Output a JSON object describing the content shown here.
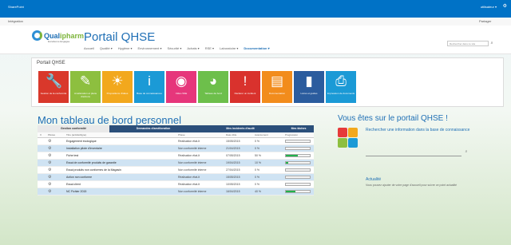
{
  "topbar": {
    "brand": "SharePoint",
    "user": "utilisateur ▾",
    "gear": "⚙"
  },
  "subbar": {
    "left": "Intégration",
    "right": "Partager"
  },
  "header": {
    "logo_word_a": "Qual",
    "logo_word_b": "ipharm",
    "logo_tag": "Excellence Engagée",
    "title": "Portail QHSE",
    "nav": [
      "Accueil",
      "Qualité ▾",
      "Hygiène ▾",
      "Environnement ▾",
      "Sécurité ▾",
      "Achats ▾",
      "RSE ▾",
      "Laboratoire ▾",
      "Documentation ▾"
    ],
    "nav_active_index": 8,
    "search_placeholder": "Rechercher dans ce site"
  },
  "portal": {
    "title": "Portail QHSE",
    "tiles": [
      {
        "label": "Gestion de la conformité",
        "icon": "wrench-icon",
        "glyph": "🔧",
        "color": "#d9382b"
      },
      {
        "label": "Amélioration et plans d'actions",
        "icon": "magic-wand-icon",
        "glyph": "✎",
        "color": "#8dbf3f"
      },
      {
        "label": "Propositions d'idées",
        "icon": "lightbulb-icon",
        "glyph": "☀",
        "color": "#f2a81d"
      },
      {
        "label": "Base de connaissances",
        "icon": "info-icon",
        "glyph": "i",
        "color": "#1b9ad6"
      },
      {
        "label": "Vidéo SSE",
        "icon": "camera-shutter-icon",
        "glyph": "◉",
        "color": "#e6367b"
      },
      {
        "label": "Tableau de bord",
        "icon": "palette-icon",
        "glyph": "◕",
        "color": "#6dbf4b"
      },
      {
        "label": "Déclarer un incident",
        "icon": "warning-icon",
        "glyph": "!",
        "color": "#d9322d"
      },
      {
        "label": "Documentation",
        "icon": "document-icon",
        "glyph": "▤",
        "color": "#f28c1c"
      },
      {
        "label": "Livres et guides",
        "icon": "book-icon",
        "glyph": "▮",
        "color": "#2b5c9e"
      },
      {
        "label": "Impression de documents",
        "icon": "printer-icon",
        "glyph": "⎙",
        "color": "#1b9ad6"
      }
    ]
  },
  "dashboard": {
    "title": "Mon tableau de bord personnel",
    "tabs": [
      "Gestion conformité",
      "Demandes d'amélioration",
      "Mes incidents d'audit",
      "Mes tâches"
    ],
    "columns": [
      "V",
      "Pilotes",
      "Titre (activité/ligne)",
      "Phase",
      "Date cible",
      "Avancement",
      "Progression"
    ],
    "rows": [
      {
        "title": "Engagement écologique",
        "phase": "Réalisation état-lt",
        "date": "15/05/2015",
        "pct": "0 %",
        "progress": 0
      },
      {
        "title": "Installation pilote d'inventaire",
        "phase": "Non conformité interne",
        "date": "21/04/2015",
        "pct": "0 %",
        "progress": 0
      },
      {
        "title": "Fiche test",
        "phase": "Réalisation état-lt",
        "date": "07/05/2015",
        "pct": "50 %",
        "progress": 50
      },
      {
        "title": "Essai de conformité produits de garantie",
        "phase": "Non conformité interne",
        "date": "19/04/2015",
        "pct": "10 %",
        "progress": 10
      },
      {
        "title": "Essai produits non conformes de la Magasin",
        "phase": "Non conformité interne",
        "date": "27/04/2015",
        "pct": "0 %",
        "progress": 0
      },
      {
        "title": "Action non conforme",
        "phase": "Réalisation état-lt",
        "date": "15/05/2015",
        "pct": "0 %",
        "progress": 0
      },
      {
        "title": "Essai client",
        "phase": "Réalisation état-lt",
        "date": "10/05/2015",
        "pct": "0 %",
        "progress": 0
      },
      {
        "title": "NC Fichier 2015",
        "phase": "Non conformité interne",
        "date": "16/04/2015",
        "pct": "40 %",
        "progress": 40
      }
    ]
  },
  "right": {
    "welcome": "Vous êtes sur le portail QHSE !",
    "search_info": "Rechercher une information dans la base de connaissance",
    "actu_title": "Actualité",
    "actu_text": "Vous pouvez ajouter de votre page d'accueil pour suivre ce point actualité"
  }
}
